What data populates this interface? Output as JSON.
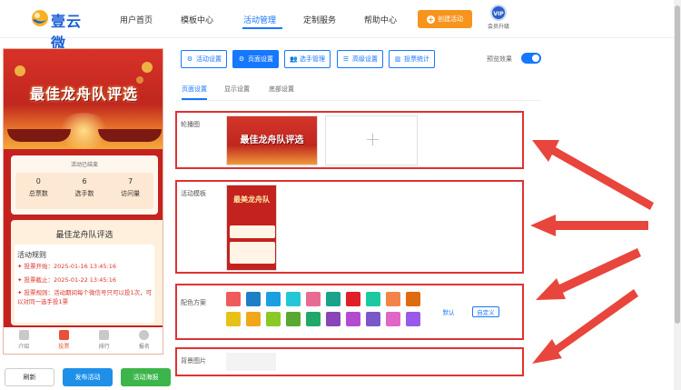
{
  "brand": {
    "name": "壹云微"
  },
  "nav": {
    "items": [
      "用户首页",
      "模板中心",
      "活动管理",
      "定制服务",
      "帮助中心"
    ],
    "active_index": 2,
    "create_label": "创建活动",
    "vip_badge": "VIP",
    "vip_label": "会员升级"
  },
  "preview": {
    "hero_title": "最佳龙舟队评选",
    "ended_label": "活动已结束",
    "stats": [
      {
        "value": "0",
        "label": "总票数"
      },
      {
        "value": "6",
        "label": "选手数"
      },
      {
        "value": "7",
        "label": "访问量"
      }
    ],
    "card_title": "最佳龙舟队评选",
    "rules_heading": "活动规则",
    "rules": [
      {
        "text": "投票开始：2025-01-16 13:45:16"
      },
      {
        "text": "投票截止：2025-01-22 13:45:16"
      },
      {
        "text": "投票规则：活动期间每个微信号只可以投1次，可以对同一选手投1票"
      }
    ],
    "tabs": [
      "介绍",
      "投票",
      "排行",
      "报名"
    ],
    "active_tab": 1
  },
  "actions": {
    "refresh": "刷新",
    "publish": "发布活动",
    "poster": "活动海报"
  },
  "toolbar": {
    "items": [
      "活动设置",
      "页面设置",
      "选手管理",
      "高级设置",
      "投票统计"
    ],
    "active_index": 1,
    "preview_effect_label": "预览效果",
    "preview_effect_on": true
  },
  "subtabs": {
    "items": [
      "页面设置",
      "显示设置",
      "底部设置"
    ],
    "active_index": 0
  },
  "sections": {
    "carousel": {
      "label": "轮播图",
      "banner_text": "最佳龙舟队评选"
    },
    "template": {
      "label": "活动模板",
      "thumb_text": "最美龙舟队"
    },
    "colors": {
      "label": "配色方案",
      "row1": [
        "#f05a5a",
        "#1e7fc6",
        "#1aa0e0",
        "#25c6d6",
        "#e86b92",
        "#1aa38a",
        "#e01f26",
        "#1cc9a3",
        "#f2844a",
        "#e06a10"
      ],
      "row2": [
        "#e8c01a",
        "#f0a81a",
        "#8ac926",
        "#5aa832",
        "#20a86a",
        "#8a44b8",
        "#b34bd1",
        "#7a58c8",
        "#e066c8",
        "#9a5ae8"
      ],
      "default_label": "默认",
      "custom_label": "自定义"
    },
    "background": {
      "label": "背景图片"
    }
  },
  "colors": {
    "accent": "#1677ff",
    "annotation_red": "#e03232",
    "orange": "#f7941d",
    "green": "#3cb54a"
  }
}
